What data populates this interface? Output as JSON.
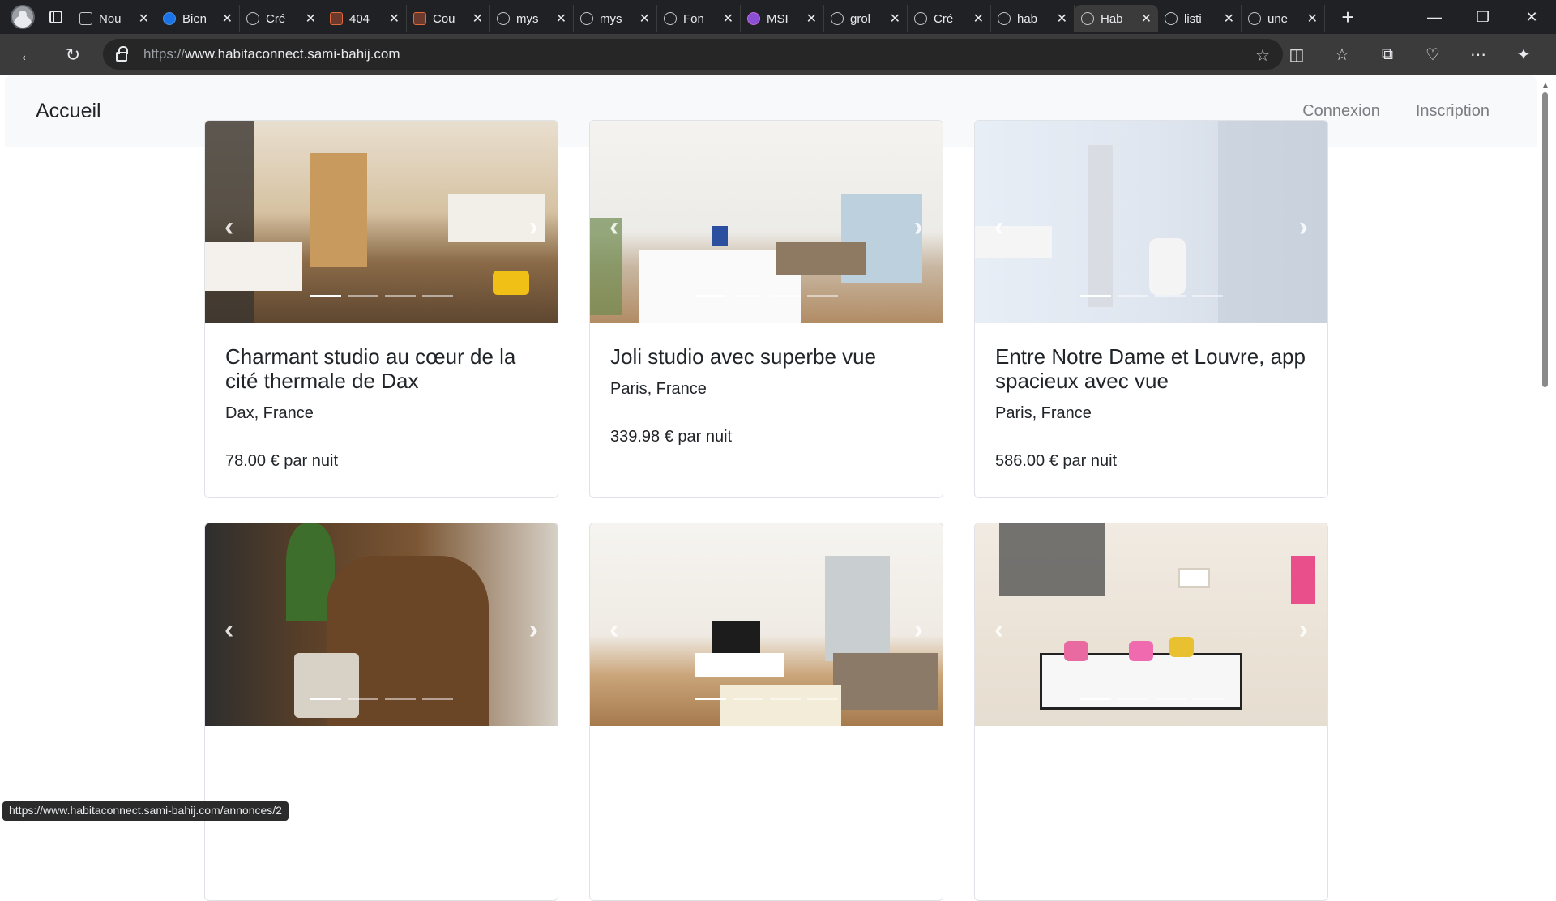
{
  "browser": {
    "tabs": [
      {
        "label": "Nou",
        "icon": "page-icon"
      },
      {
        "label": "Bien",
        "icon": "edge-icon"
      },
      {
        "label": "Cré",
        "icon": "globe-icon"
      },
      {
        "label": "404",
        "icon": "site-icon"
      },
      {
        "label": "Cou",
        "icon": "site-icon"
      },
      {
        "label": "mys",
        "icon": "globe-icon"
      },
      {
        "label": "mys",
        "icon": "globe-icon"
      },
      {
        "label": "Fon",
        "icon": "globe-icon"
      },
      {
        "label": "MSI",
        "icon": "site-icon"
      },
      {
        "label": "grol",
        "icon": "search-icon"
      },
      {
        "label": "Cré",
        "icon": "site-icon"
      },
      {
        "label": "hab",
        "icon": "search-icon"
      },
      {
        "label": "Hab",
        "icon": "globe-icon",
        "active": true
      },
      {
        "label": "listi",
        "icon": "globe-icon"
      },
      {
        "label": "une",
        "icon": "search-icon"
      }
    ],
    "url_protocol": "https://",
    "url_host": "www.habitaconnect.sami-bahij.com",
    "status_url": "https://www.habitaconnect.sami-bahij.com/annonces/2"
  },
  "site": {
    "brand": "Accueil",
    "nav": {
      "login": "Connexion",
      "signup": "Inscription"
    }
  },
  "listings": [
    {
      "title": "Charmant studio au cœur de la cité thermale de Dax",
      "location": "Dax, France",
      "price": "78.00 € par nuit",
      "photos": 4,
      "active_photo": 0
    },
    {
      "title": "Joli studio avec superbe vue",
      "location": "Paris, France",
      "price": "339.98 € par nuit",
      "photos": 4,
      "active_photo": 0
    },
    {
      "title": "Entre Notre Dame et Louvre, app spacieux avec vue",
      "location": "Paris, France",
      "price": "586.00 € par nuit",
      "photos": 4,
      "active_photo": 0
    },
    {
      "title": "",
      "location": "",
      "price": "",
      "photos": 4,
      "active_photo": 0
    },
    {
      "title": "",
      "location": "",
      "price": "",
      "photos": 4,
      "active_photo": 0
    },
    {
      "title": "",
      "location": "",
      "price": "",
      "photos": 4,
      "active_photo": 0
    }
  ]
}
